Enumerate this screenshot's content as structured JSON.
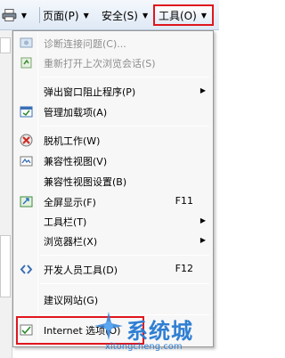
{
  "toolbar": {
    "page_label": "页面(P)",
    "safety_label": "安全(S)",
    "tools_label": "工具(O)"
  },
  "menu": {
    "items": [
      {
        "label": "诊断连接问题(C)...",
        "disabled": true
      },
      {
        "label": "重新打开上次浏览会话(S)",
        "disabled": true
      },
      {
        "label": "弹出窗口阻止程序(P)"
      },
      {
        "label": "管理加载项(A)"
      },
      {
        "label": "脱机工作(W)"
      },
      {
        "label": "兼容性视图(V)"
      },
      {
        "label": "兼容性视图设置(B)"
      },
      {
        "label": "全屏显示(F)",
        "shortcut": "F11"
      },
      {
        "label": "工具栏(T)"
      },
      {
        "label": "浏览器栏(X)"
      },
      {
        "label": "开发人员工具(D)",
        "shortcut": "F12"
      },
      {
        "label": "建议网站(G)"
      },
      {
        "label": "Internet 选项(O)"
      }
    ]
  },
  "watermark": {
    "name": "系统城",
    "url": "xitongcheng.com"
  },
  "colors": {
    "highlight_border": "#e0161e",
    "watermark": "#2f7fd3"
  }
}
